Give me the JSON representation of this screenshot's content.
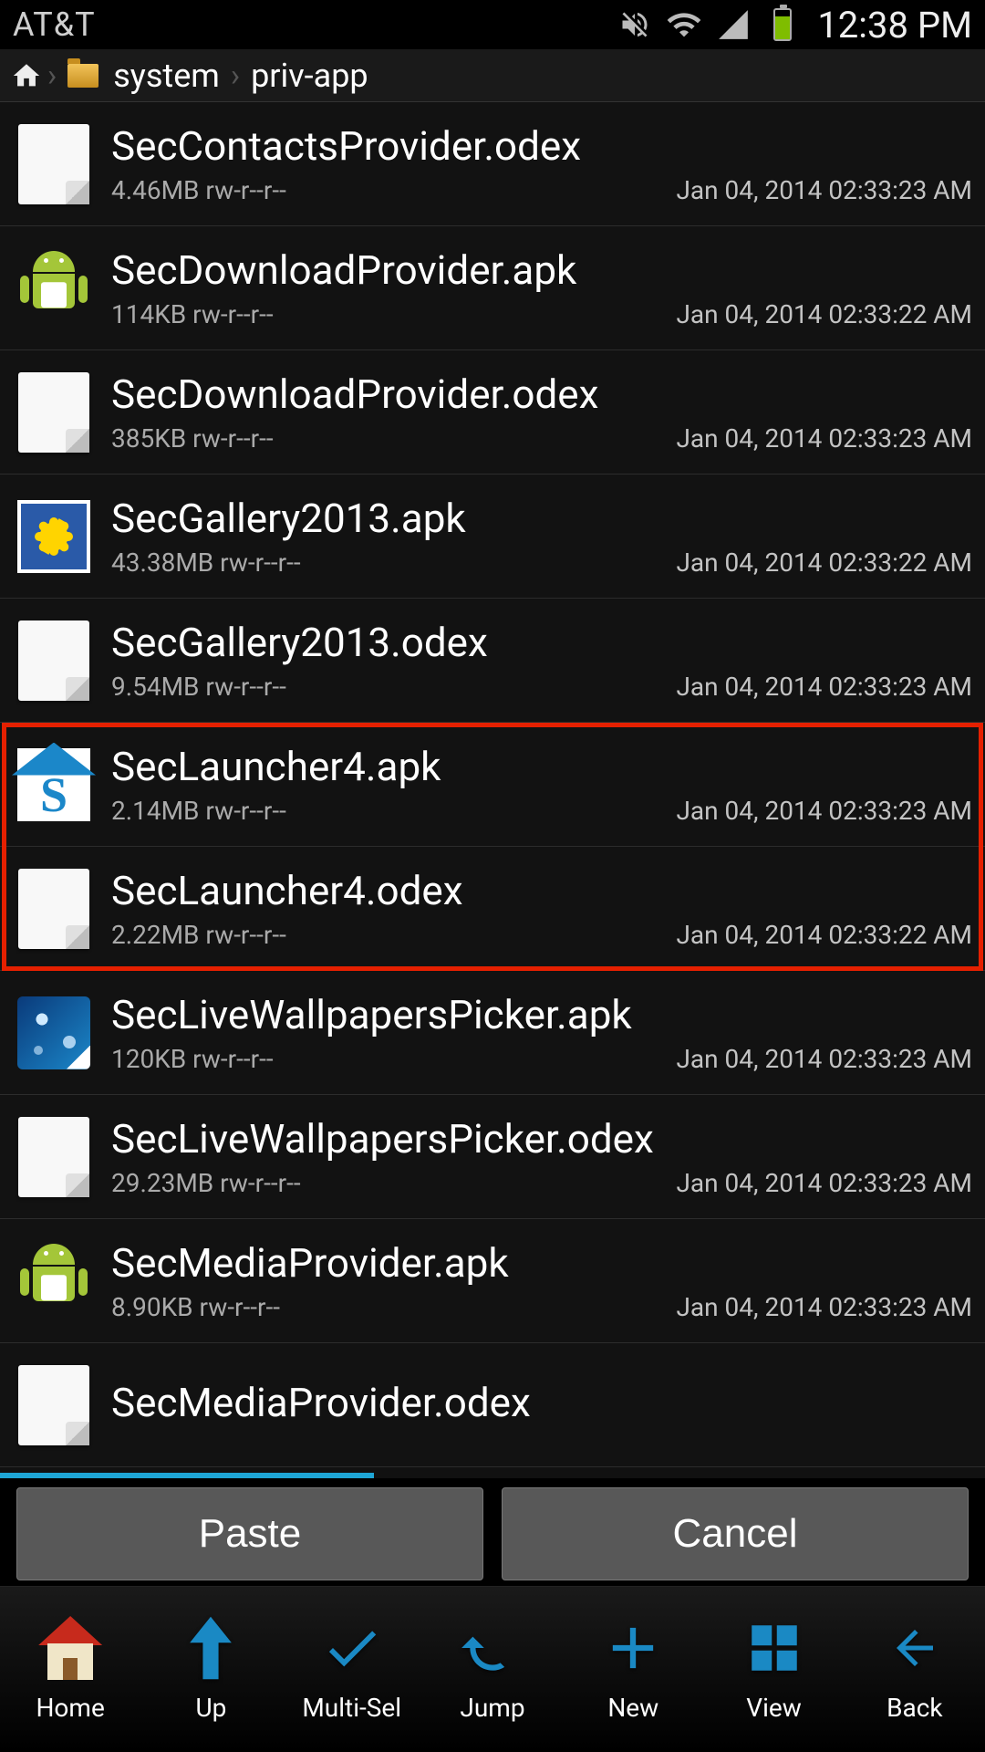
{
  "statusbar": {
    "carrier": "AT&T",
    "time": "12:38 PM"
  },
  "breadcrumbs": {
    "items": [
      "system",
      "priv-app"
    ]
  },
  "files": [
    {
      "name": "SecContactsProvider.odex",
      "size": "4.46MB",
      "perm": "rw-r--r--",
      "date": "Jan 04, 2014 02:33:23 AM",
      "icon": "doc"
    },
    {
      "name": "SecDownloadProvider.apk",
      "size": "114KB",
      "perm": "rw-r--r--",
      "date": "Jan 04, 2014 02:33:22 AM",
      "icon": "apk"
    },
    {
      "name": "SecDownloadProvider.odex",
      "size": "385KB",
      "perm": "rw-r--r--",
      "date": "Jan 04, 2014 02:33:23 AM",
      "icon": "doc"
    },
    {
      "name": "SecGallery2013.apk",
      "size": "43.38MB",
      "perm": "rw-r--r--",
      "date": "Jan 04, 2014 02:33:22 AM",
      "icon": "gallery"
    },
    {
      "name": "SecGallery2013.odex",
      "size": "9.54MB",
      "perm": "rw-r--r--",
      "date": "Jan 04, 2014 02:33:23 AM",
      "icon": "doc"
    },
    {
      "name": "SecLauncher4.apk",
      "size": "2.14MB",
      "perm": "rw-r--r--",
      "date": "Jan 04, 2014 02:33:23 AM",
      "icon": "launcher"
    },
    {
      "name": "SecLauncher4.odex",
      "size": "2.22MB",
      "perm": "rw-r--r--",
      "date": "Jan 04, 2014 02:33:22 AM",
      "icon": "doc"
    },
    {
      "name": "SecLiveWallpapersPicker.apk",
      "size": "120KB",
      "perm": "rw-r--r--",
      "date": "Jan 04, 2014 02:33:23 AM",
      "icon": "wallpaper"
    },
    {
      "name": "SecLiveWallpapersPicker.odex",
      "size": "29.23MB",
      "perm": "rw-r--r--",
      "date": "Jan 04, 2014 02:33:23 AM",
      "icon": "doc"
    },
    {
      "name": "SecMediaProvider.apk",
      "size": "8.90KB",
      "perm": "rw-r--r--",
      "date": "Jan 04, 2014 02:33:23 AM",
      "icon": "apk"
    },
    {
      "name": "SecMediaProvider.odex",
      "size": "",
      "perm": "",
      "date": "",
      "icon": "doc"
    }
  ],
  "highlight": {
    "start_index": 5,
    "end_index": 6
  },
  "actions": {
    "paste": "Paste",
    "cancel": "Cancel"
  },
  "toolbar": [
    {
      "label": "Home",
      "icon": "home"
    },
    {
      "label": "Up",
      "icon": "up"
    },
    {
      "label": "Multi-Sel",
      "icon": "check"
    },
    {
      "label": "Jump",
      "icon": "jump"
    },
    {
      "label": "New",
      "icon": "plus"
    },
    {
      "label": "View",
      "icon": "grid"
    },
    {
      "label": "Back",
      "icon": "back"
    }
  ]
}
